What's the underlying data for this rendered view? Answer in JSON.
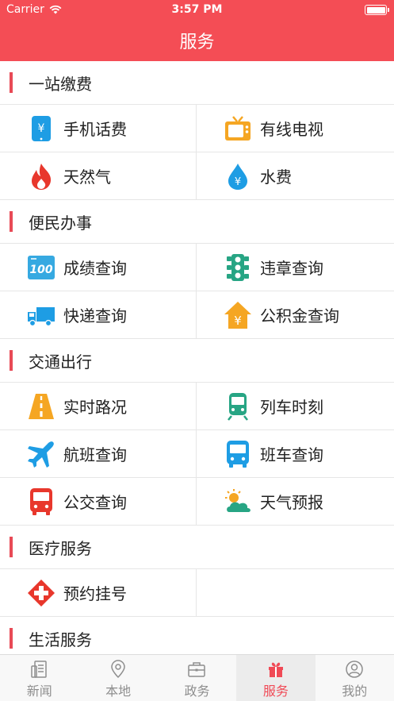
{
  "status_bar": {
    "carrier": "Carrier",
    "time": "3:57 PM"
  },
  "header": {
    "title": "服务"
  },
  "sections": [
    {
      "title": "一站缴费",
      "items": [
        {
          "label": "手机话费",
          "icon": "mobile-yuan-icon"
        },
        {
          "label": "有线电视",
          "icon": "tv-icon"
        },
        {
          "label": "天然气",
          "icon": "flame-icon"
        },
        {
          "label": "水费",
          "icon": "water-drop-icon"
        }
      ]
    },
    {
      "title": "便民办事",
      "items": [
        {
          "label": "成绩查询",
          "icon": "score-100-icon"
        },
        {
          "label": "违章查询",
          "icon": "traffic-light-icon"
        },
        {
          "label": "快递查询",
          "icon": "delivery-truck-icon"
        },
        {
          "label": "公积金查询",
          "icon": "house-yuan-icon"
        }
      ]
    },
    {
      "title": "交通出行",
      "items": [
        {
          "label": "实时路况",
          "icon": "road-icon"
        },
        {
          "label": "列车时刻",
          "icon": "train-icon"
        },
        {
          "label": "航班查询",
          "icon": "airplane-icon"
        },
        {
          "label": "班车查询",
          "icon": "shuttle-bus-icon"
        },
        {
          "label": "公交查询",
          "icon": "city-bus-icon"
        },
        {
          "label": "天气预报",
          "icon": "weather-icon"
        }
      ]
    },
    {
      "title": "医疗服务",
      "items": [
        {
          "label": "预约挂号",
          "icon": "medical-cross-icon"
        }
      ]
    },
    {
      "title": "生活服务",
      "items": []
    }
  ],
  "tabbar": {
    "tabs": [
      {
        "label": "新闻",
        "icon": "news-icon",
        "active": false
      },
      {
        "label": "本地",
        "icon": "location-pin-icon",
        "active": false
      },
      {
        "label": "政务",
        "icon": "briefcase-icon",
        "active": false
      },
      {
        "label": "服务",
        "icon": "gift-icon",
        "active": true
      },
      {
        "label": "我的",
        "icon": "user-icon",
        "active": false
      }
    ]
  },
  "colors": {
    "accent": "#f44d55",
    "section_bar": "#e84a56",
    "tab_active": "#f04a56",
    "tab_inactive": "#8e8e8e"
  }
}
